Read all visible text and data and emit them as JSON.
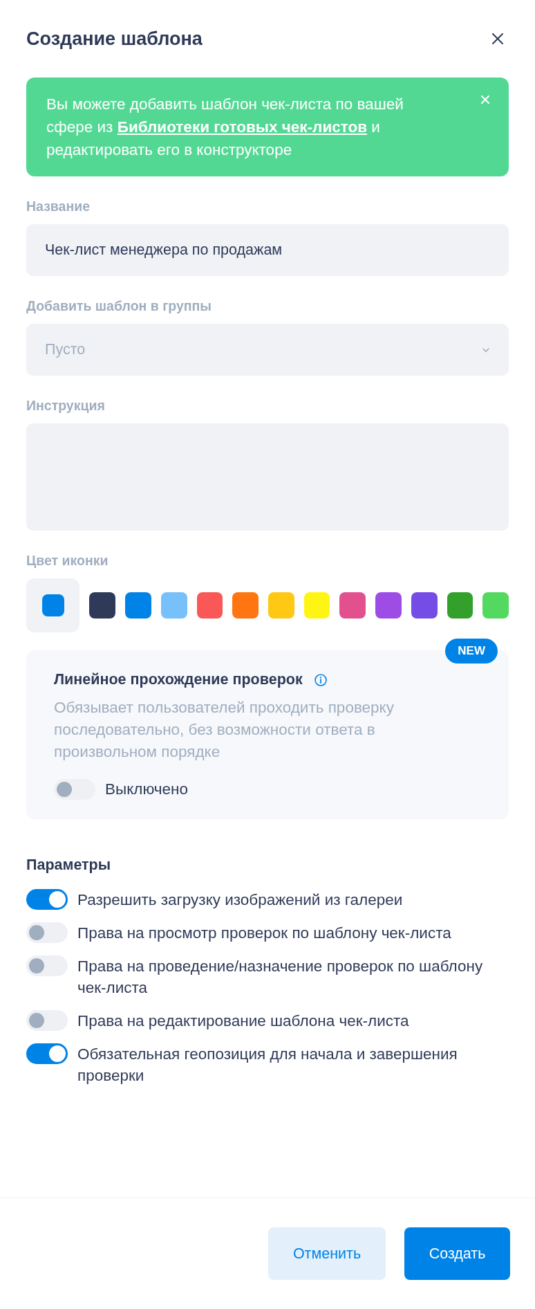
{
  "dialog": {
    "title": "Создание шаблона"
  },
  "banner": {
    "text_before": "Вы можете добавить шаблон чек-листа по вашей сфере из ",
    "link": "Библиотеки готовых чек-листов",
    "text_after": " и редактировать его в конструкторе"
  },
  "fields": [
    {
      "kind": "input",
      "label": "Название",
      "value": "Чек-лист менеджера по продажам"
    },
    {
      "kind": "select",
      "label": "Добавить шаблон в группы",
      "placeholder": "Пусто"
    },
    {
      "kind": "textarea",
      "label": "Инструкция"
    }
  ],
  "icon_color": {
    "label": "Цвет иконки",
    "color": "#0083e6",
    "swatches": [
      {
        "color": "#2e3a57"
      },
      {
        "color": "#0083e6"
      },
      {
        "color": "#77c0fa"
      },
      {
        "color": "#fa5757"
      },
      {
        "color": "#ff7511"
      },
      {
        "color": "#ffc814"
      },
      {
        "color": "#fff514"
      },
      {
        "color": "#e2508d"
      },
      {
        "color": "#9e4ce6"
      },
      {
        "color": "#754ce6"
      },
      {
        "color": "#33a02c"
      },
      {
        "color": "#53d860"
      }
    ]
  },
  "linear": {
    "badge": "NEW",
    "title": "Линейное прохождение проверок",
    "description": "Обязывает пользователей проходить проверку последовательно, без возможности ответа в произвольном порядке",
    "on": false,
    "state_label": "Выключено"
  },
  "parameters": {
    "title": "Параметры",
    "items": [
      {
        "label": "Разрешить загрузку изображений из галереи",
        "on": true
      },
      {
        "label": "Права на просмотр проверок по шаблону чек-листа",
        "on": false
      },
      {
        "label": "Права на проведение/назначение проверок по шаблону чек-листа",
        "on": false
      },
      {
        "label": "Права на редактирование шаблона чек-листа",
        "on": false
      },
      {
        "label": "Обязательная геопозиция для начала и завершения проверки",
        "on": true
      }
    ]
  },
  "buttons": {
    "cancel": "Отменить",
    "create": "Создать"
  }
}
